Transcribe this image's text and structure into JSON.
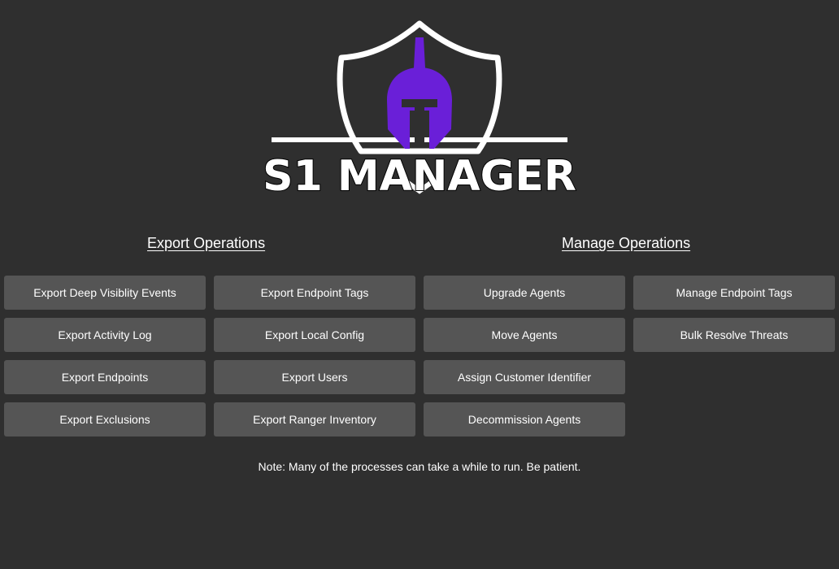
{
  "logo": {
    "text": "S1 MANAGER",
    "accent_color": "#6a1fd8",
    "outline_color": "#ffffff"
  },
  "export_operations": {
    "title": "Export Operations",
    "buttons": [
      "Export Deep Visiblity Events",
      "Export Endpoint Tags",
      "Export Activity Log",
      "Export Local Config",
      "Export Endpoints",
      "Export Users",
      "Export Exclusions",
      "Export Ranger Inventory"
    ]
  },
  "manage_operations": {
    "title": "Manage Operations",
    "buttons": [
      "Upgrade Agents",
      "Manage Endpoint Tags",
      "Move Agents",
      "Bulk Resolve Threats",
      "Assign Customer Identifier",
      "Decommission Agents"
    ]
  },
  "note": "Note: Many of the processes can take a while to run. Be patient."
}
